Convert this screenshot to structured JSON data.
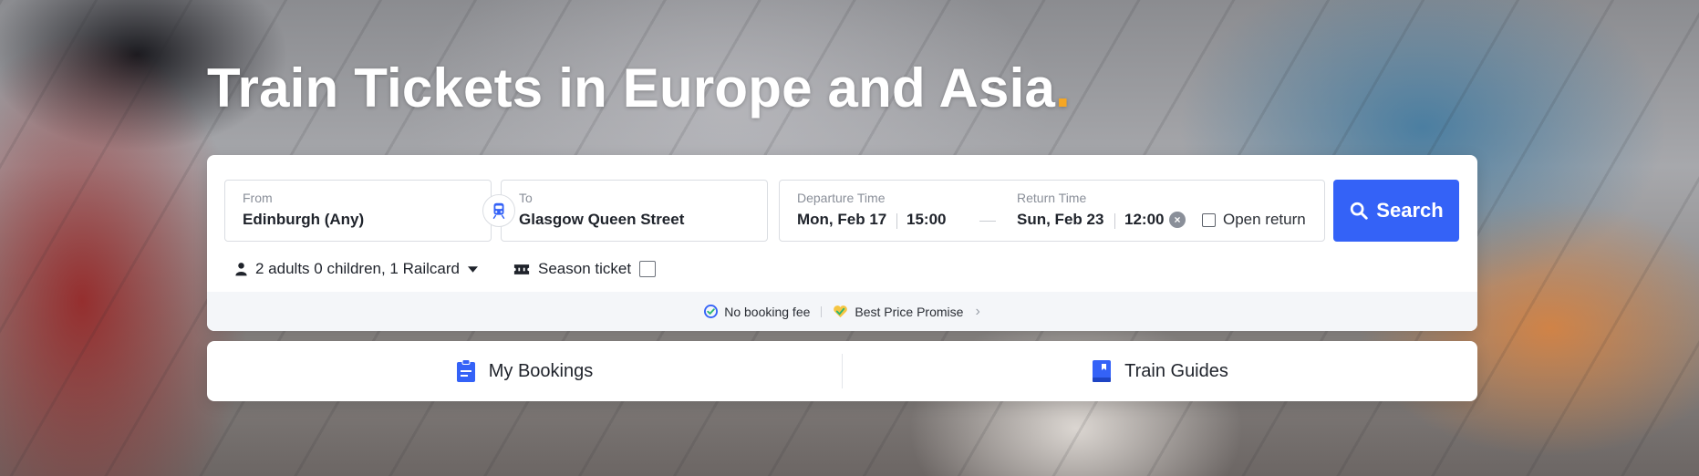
{
  "hero": {
    "title": "Train Tickets in Europe and Asia",
    "title_dot": "."
  },
  "search": {
    "from_label": "From",
    "from_value": "Edinburgh (Any)",
    "to_label": "To",
    "to_value": "Glasgow Queen Street",
    "departure_label": "Departure Time",
    "departure_date": "Mon, Feb 17",
    "departure_time": "15:00",
    "return_label": "Return Time",
    "return_date": "Sun, Feb 23",
    "return_time": "12:00",
    "open_return_label": "Open return",
    "search_button_label": "Search",
    "passengers_label": "2 adults 0 children, 1 Railcard",
    "season_ticket_label": "Season ticket"
  },
  "promises": {
    "no_booking_fee": "No booking fee",
    "best_price": "Best Price Promise"
  },
  "links": {
    "my_bookings": "My Bookings",
    "train_guides": "Train Guides"
  },
  "colors": {
    "accent": "#3462f7",
    "title_dot": "#f5a623"
  }
}
